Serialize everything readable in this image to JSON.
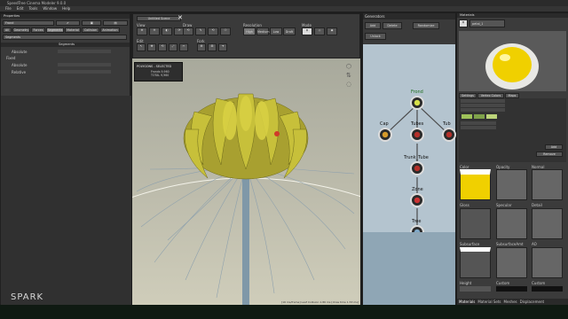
{
  "window": {
    "title": "SpeedTree Cinema Modeler 9.0.0"
  },
  "menu": [
    "File",
    "Edit",
    "Tools",
    "Window",
    "Help"
  ],
  "left_panel": {
    "title": "Properties",
    "generator_label": "Frond",
    "tabs": [
      "All",
      "Geometry",
      "Forces",
      "Segments",
      "Material",
      "Collision",
      "Animation"
    ],
    "dropdown": "Segments",
    "section": "Segments",
    "rows": [
      "Absolute",
      "Fixed",
      "Absolute",
      "Relative"
    ]
  },
  "viewport": {
    "tab_label": "Untitled Scene",
    "toolbar_labels": [
      "View",
      "Draw",
      "Resolution",
      "Mode",
      "Edit",
      "Fork"
    ],
    "resolution_options": [
      "High",
      "Medium",
      "Low",
      "Draft"
    ],
    "stats": {
      "title": "POLYGONS - SELECTED",
      "line1": "Fronds 9,960",
      "line2": "TOTAL 9,960"
    },
    "status": "[16 ms/frame] Leaf Collision 1.86 ms [draw time 1.53 ms]"
  },
  "generators": {
    "title": "Generators",
    "buttons": [
      "Add",
      "Delete",
      "Randomize",
      "Unlock"
    ],
    "nodes": [
      {
        "label": "Frond",
        "color": "#d7e04a"
      },
      {
        "label": "Cap",
        "color": "#d59a2a"
      },
      {
        "label": "Tubes",
        "color": "#b5302a"
      },
      {
        "label": "Tub",
        "color": "#b5302a"
      },
      {
        "label": "Trunk_Tube",
        "color": "#b5302a"
      },
      {
        "label": "Zone",
        "color": "#c33"
      },
      {
        "label": "Tree",
        "color": "#7fa9c9"
      }
    ]
  },
  "materials": {
    "title": "Materials",
    "selected": "petal_1",
    "section_labels": [
      "Settings",
      "Vertex Colors",
      "Maps"
    ],
    "swatch_labels": [
      "Color",
      "Opacity",
      "Normal",
      "Gloss",
      "Specular",
      "Detail",
      "Subsurface",
      "SubsurfaceAmt",
      "AO",
      "Height",
      "Custom",
      "Custom"
    ],
    "color_value": "#f0d000",
    "buttons": [
      "Add",
      "Remove"
    ],
    "bottom_tabs": [
      "Materials",
      "Material Sets",
      "Meshes",
      "Displacement"
    ]
  },
  "watermark": "SPARK"
}
